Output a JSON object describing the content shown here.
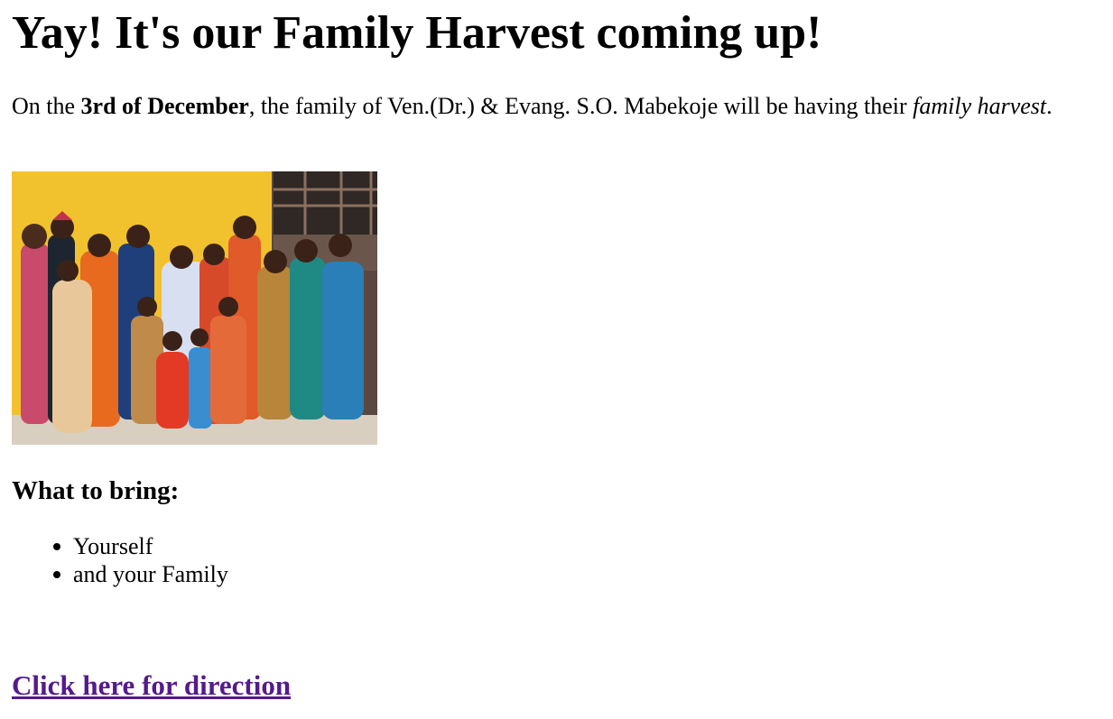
{
  "header": {
    "title": "Yay! It's our Family Harvest coming up!"
  },
  "intro": {
    "prefix": "On the ",
    "date": "3rd of December",
    "middle": ", the family of Ven.(Dr.) & Evang. S.O. Mabekoje will be having their ",
    "event": "family harvest",
    "suffix": "."
  },
  "photo": {
    "description_icon": "family-photo",
    "colors": {
      "wall": "#f2c12e",
      "floor": "#d8cfc0",
      "door": "#4a3a32"
    }
  },
  "bring": {
    "heading": "What to bring:",
    "items": [
      "Yourself",
      "and your Family"
    ]
  },
  "link": {
    "label": "Click here for direction",
    "color": "#551a8b"
  }
}
